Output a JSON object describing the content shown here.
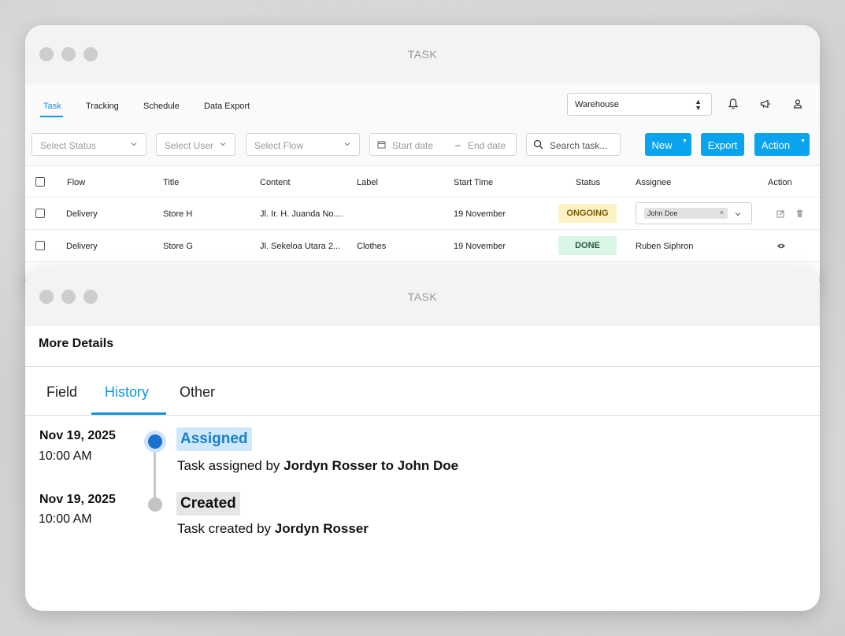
{
  "window_title": "TASK",
  "nav": {
    "tabs": [
      "Task",
      "Tracking",
      "Schedule",
      "Data Export"
    ],
    "active_tab": "Task",
    "warehouse_select": "Warehouse"
  },
  "filters": {
    "status_placeholder": "Select Status",
    "user_placeholder": "Select User",
    "flow_placeholder": "Select Flow",
    "start_date_placeholder": "Start date",
    "date_separator": "–",
    "end_date_placeholder": "End date",
    "search_placeholder": "Search task...",
    "new_label": "New",
    "export_label": "Export",
    "action_label": "Action"
  },
  "table": {
    "columns": [
      "Flow",
      "Title",
      "Content",
      "Label",
      "Start Time",
      "Status",
      "Assignee",
      "Action"
    ],
    "rows": [
      {
        "flow": "Delivery",
        "title": "Store H",
        "content": "Jl. Ir. H. Juanda No....",
        "label": "",
        "start_time": "19 November",
        "status": "ONGOING",
        "assignee": "John Doe"
      },
      {
        "flow": "Delivery",
        "title": "Store G",
        "content": "Jl. Sekeloa Utara 2...",
        "label": "Clothes",
        "start_time": "19 November",
        "status": "DONE",
        "assignee": "Ruben Siphron"
      }
    ]
  },
  "details": {
    "title": "More Details",
    "tabs": [
      "Field",
      "History",
      "Other"
    ],
    "active_tab": "History",
    "history": [
      {
        "date": "Nov 19, 2025",
        "time": "10:00 AM",
        "event": "Assigned",
        "desc_prefix": "Task assigned by",
        "desc_actor": "Jordyn Rosser to John Doe"
      },
      {
        "date": "Nov 19, 2025",
        "time": "10:00 AM",
        "event": "Created",
        "desc_prefix": "Task created by",
        "desc_actor": "Jordyn Rosser"
      }
    ]
  },
  "colors": {
    "accent": "#1296db",
    "button": "#0aa3ee",
    "ongoing_bg": "#fdf2c4",
    "ongoing_text": "#7a5a00",
    "done_bg": "#d9f5e6",
    "done_text": "#2a5a40",
    "assigned_bg": "#cfe8fb",
    "assigned_text": "#1a7fc9",
    "created_bg": "#e6e6e6",
    "timeline_active": "#1a6fd0",
    "timeline_inactive": "#c4c4c4"
  }
}
